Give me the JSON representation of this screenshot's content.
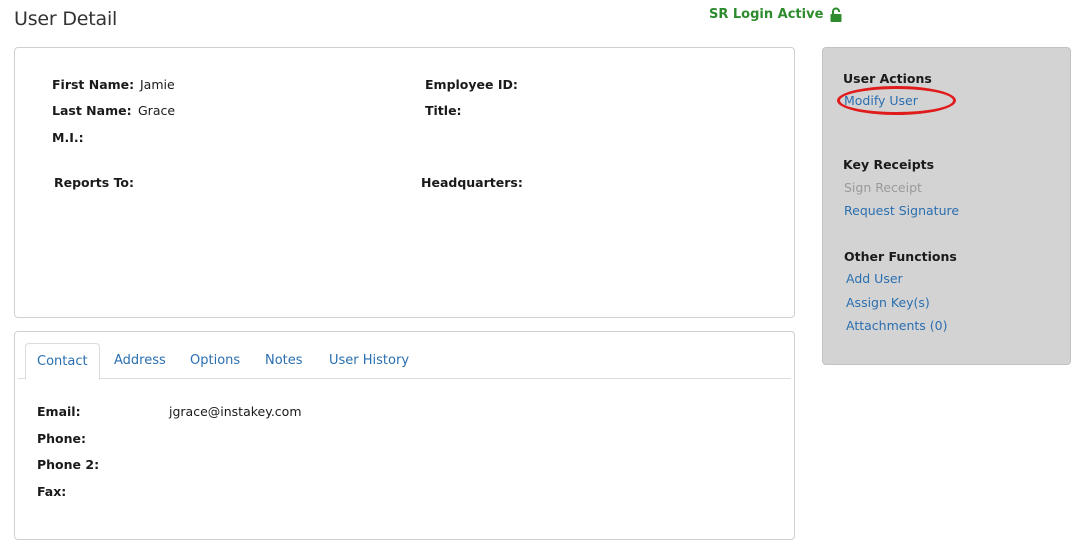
{
  "page": {
    "title": "User Detail"
  },
  "login_status": {
    "text": "SR Login Active",
    "icon": "unlocked-lock-icon",
    "color": "#2e8b2e"
  },
  "user_info": {
    "first_name_label": "First Name:",
    "first_name": "Jamie",
    "last_name_label": "Last Name:",
    "last_name": "Grace",
    "mi_label": "M.I.:",
    "mi": "",
    "employee_id_label": "Employee ID:",
    "employee_id": "",
    "title_label": "Title:",
    "title": "",
    "reports_to_label": "Reports To:",
    "reports_to": "",
    "headquarters_label": "Headquarters:",
    "headquarters": ""
  },
  "tabs": [
    {
      "label": "Contact",
      "active": true
    },
    {
      "label": "Address",
      "active": false
    },
    {
      "label": "Options",
      "active": false
    },
    {
      "label": "Notes",
      "active": false
    },
    {
      "label": "User History",
      "active": false
    }
  ],
  "contact": {
    "email_label": "Email:",
    "email": "jgrace@instakey.com",
    "phone_label": "Phone:",
    "phone": "",
    "phone2_label": "Phone 2:",
    "phone2": "",
    "fax_label": "Fax:",
    "fax": ""
  },
  "actions": {
    "user_actions_title": "User Actions",
    "modify_user": "Modify User",
    "key_receipts_title": "Key Receipts",
    "sign_receipt": "Sign Receipt",
    "request_signature": "Request Signature",
    "other_functions_title": "Other Functions",
    "add_user": "Add User",
    "assign_keys": "Assign Key(s)",
    "attachments": "Attachments (0)"
  },
  "colors": {
    "link": "#2a6fb0",
    "disabled": "#9a9a9a",
    "highlight": "#e01b1b",
    "panel_bg": "#d3d3d3"
  }
}
